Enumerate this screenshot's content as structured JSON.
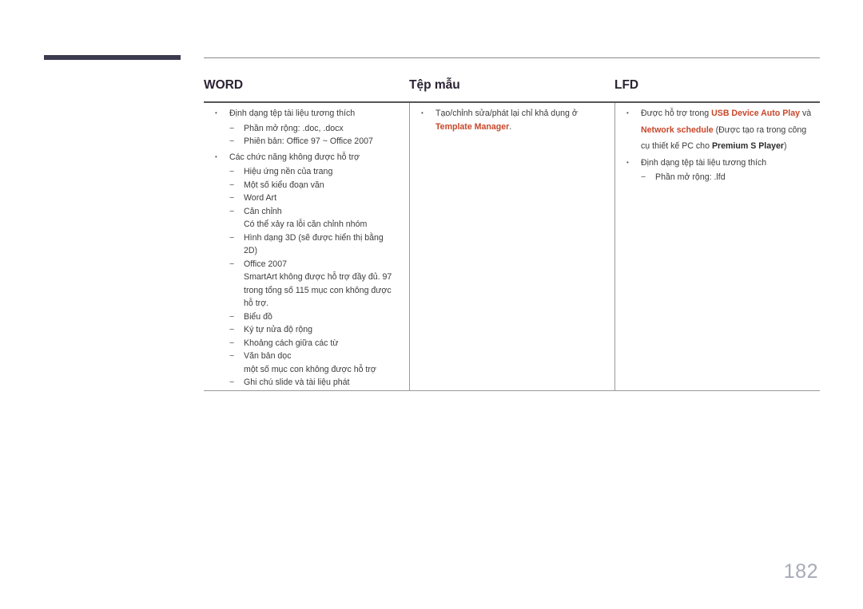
{
  "page_number": "182",
  "columns": [
    {
      "title": "WORD"
    },
    {
      "title": "Tệp mẫu"
    },
    {
      "title": "LFD"
    }
  ],
  "word": {
    "bullet1": "Định dạng tệp tài liệu tương thích",
    "ext": "Phần mở rộng: .doc, .docx",
    "version": "Phiên bản: Office 97 ~ Office 2007",
    "bullet2": "Các chức năng không được hỗ trợ",
    "items": [
      "Hiệu ứng nền của trang",
      "Một số kiểu đoạn văn",
      "Word Art",
      "Căn chỉnh"
    ],
    "align_note": "Có thể xảy ra lỗi căn chỉnh nhóm",
    "shape3d": "Hình dạng 3D (sẽ được hiển thị bằng 2D)",
    "office2007": "Office 2007",
    "office2007_note": "SmartArt không được hỗ trợ đầy đủ. 97 trong tổng số 115 mục con không được hỗ trợ.",
    "items2": [
      "Biểu đồ",
      "Ký tự nửa độ rộng",
      "Khoảng cách giữa các từ",
      "Văn bản dọc"
    ],
    "vertical_note": "một số mục con không được hỗ trợ",
    "last": "Ghi chú slide và tài liệu phát"
  },
  "template": {
    "text": "Tạo/chỉnh sửa/phát lại chỉ khả dụng ở",
    "link": "Template Manager",
    "end": "."
  },
  "lfd": {
    "pre": "Được hỗ trợ trong",
    "usb": "USB Device Auto Play",
    "and": "và",
    "network": "Network schedule",
    "mid": "(Được tạo ra trong công cụ thiết kế PC cho",
    "premium": "Premium S Player",
    "close": ")",
    "bullet2": "Định dạng tệp tài liệu tương thích",
    "ext": "Phần mở rộng: .lfd"
  }
}
